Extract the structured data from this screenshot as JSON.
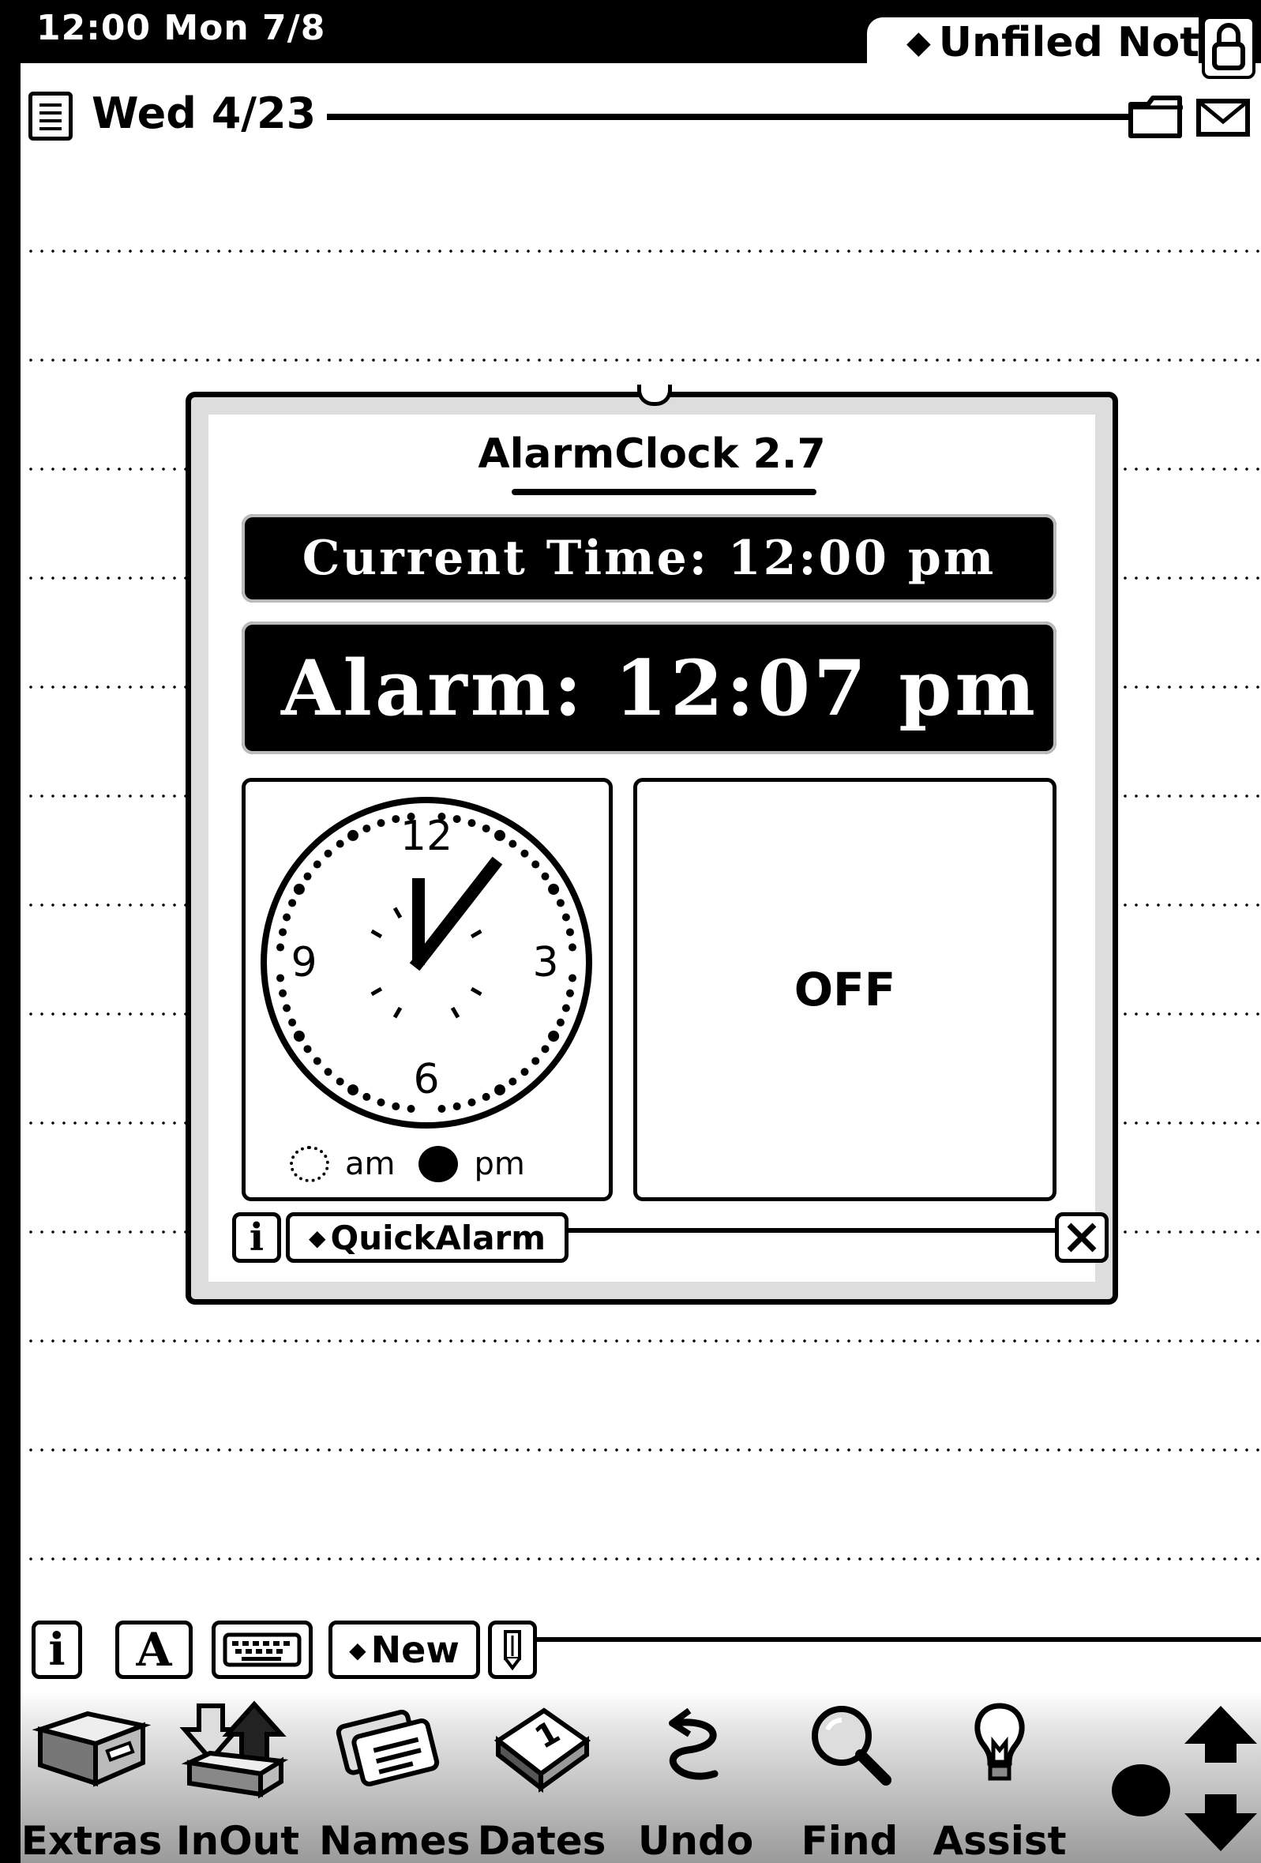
{
  "status_bar": {
    "clock": "12:00 Mon 7/8",
    "folder_tab": "Unfiled Note"
  },
  "note": {
    "date": "Wed 4/23"
  },
  "dialog": {
    "title": "AlarmClock 2.7",
    "current_time": "Current Time: 12:00 pm",
    "alarm_time": "Alarm: 12:07 pm",
    "clock_numbers": {
      "twelve": "12",
      "three": "3",
      "six": "6",
      "nine": "9"
    },
    "am_label": "am",
    "pm_label": "pm",
    "selected_period": "pm",
    "status": "OFF",
    "info_label": "i",
    "quickalarm_label": "QuickAlarm"
  },
  "toolbar": {
    "info_label": "i",
    "style_label": "A",
    "new_label": "New"
  },
  "dock": {
    "items": [
      {
        "label": "Extras",
        "icon": "extras-icon"
      },
      {
        "label": "InOut",
        "icon": "inout-icon"
      },
      {
        "label": "Names",
        "icon": "names-icon"
      },
      {
        "label": "Dates",
        "icon": "dates-icon"
      },
      {
        "label": "Undo",
        "icon": "undo-icon"
      },
      {
        "label": "Find",
        "icon": "find-icon"
      },
      {
        "label": "Assist",
        "icon": "assist-icon"
      }
    ]
  }
}
